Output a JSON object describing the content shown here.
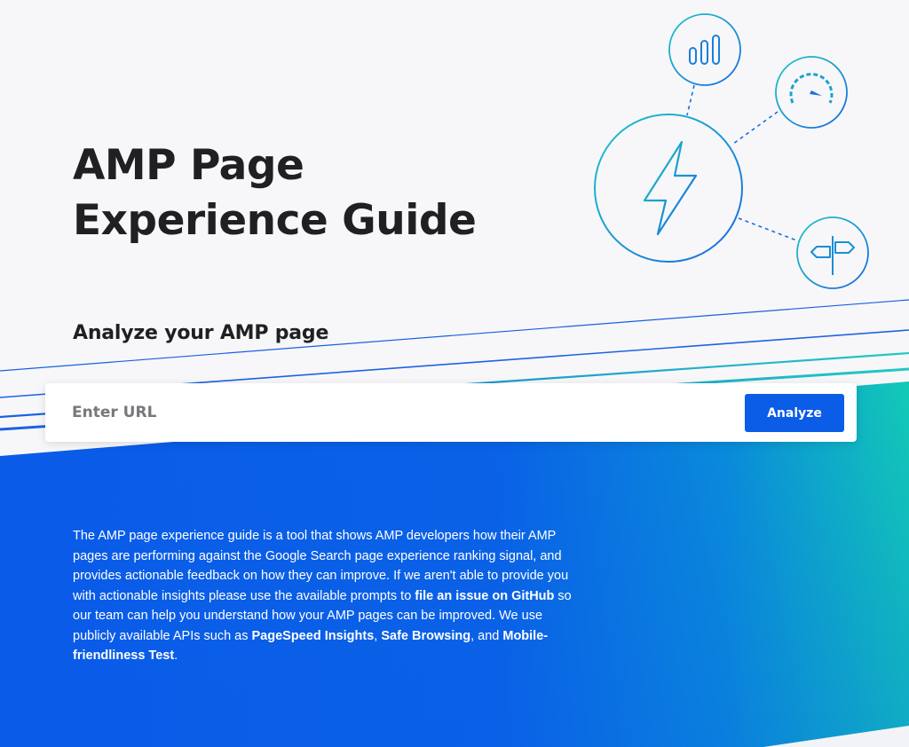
{
  "hero": {
    "title_line1": "AMP Page",
    "title_line2": "Experience Guide"
  },
  "analyze": {
    "heading": "Analyze your AMP page",
    "input_placeholder": "Enter URL",
    "button_label": "Analyze"
  },
  "description": {
    "text_1": "The AMP page experience guide is a tool that shows AMP developers how their AMP pages are performing against the Google Search page experience ranking signal, and provides actionable feedback on how they can improve. If we aren't able to provide you with actionable insights please use the available prompts to ",
    "link_issue": "file an issue on GitHub",
    "text_2": " so our team can help you understand how your AMP pages can be improved. We use publicly available APIs such as ",
    "link_psi": "PageSpeed Insights",
    "text_3": ", ",
    "link_safe": "Safe Browsing",
    "text_4": ", and ",
    "link_mobile": "Mobile-friendliness Test",
    "text_5": "."
  },
  "illustration": {
    "center_icon": "lightning-bolt-icon",
    "satellite_icons": [
      "bar-chart-icon",
      "speedometer-icon",
      "signpost-icon"
    ]
  },
  "colors": {
    "accent_blue": "#0b5ce6",
    "band_blue": "#0a5be8",
    "band_teal": "#14cfb4",
    "text_dark": "#1f1f24"
  }
}
